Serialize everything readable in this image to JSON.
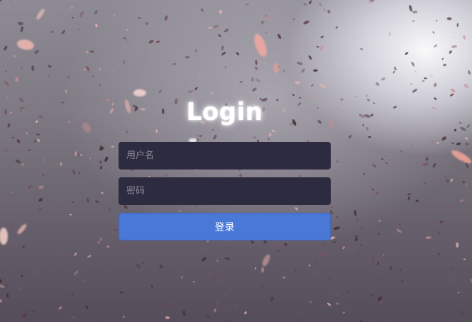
{
  "login": {
    "title": "Login",
    "username_placeholder": "用户名",
    "password_placeholder": "密码",
    "submit_label": "登录"
  },
  "colors": {
    "input_background": "#2d2b40",
    "button_background": "#4a78d6",
    "title_color": "#ffffff"
  }
}
